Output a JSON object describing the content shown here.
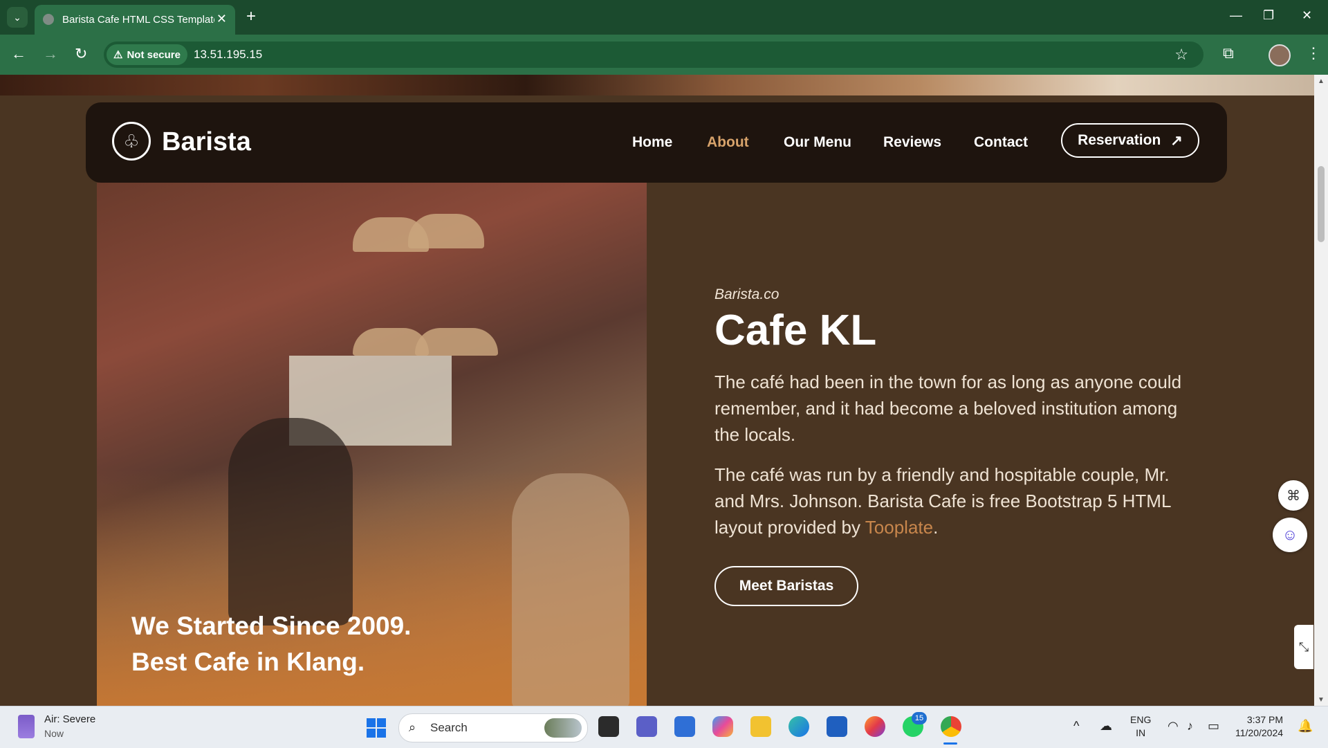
{
  "browser": {
    "tab_title": "Barista Cafe HTML CSS Template",
    "security_label": "Not secure",
    "url": "13.51.195.15"
  },
  "nav": {
    "brand": "Barista",
    "links": [
      "Home",
      "About",
      "Our Menu",
      "Reviews",
      "Contact"
    ],
    "active": "About",
    "reservation_label": "Reservation"
  },
  "photo": {
    "caption_line1": "We Started Since 2009.",
    "caption_line2": "Best Cafe in Klang."
  },
  "about": {
    "eyebrow": "Barista.co",
    "heading": "Cafe KL",
    "para1": "The café had been in the town for as long as anyone could remember, and it had become a beloved institution among the locals.",
    "para2_prefix": "The café was run by a friendly and hospitable couple, Mr. and Mrs. Johnson. Barista Cafe is free Bootstrap 5 HTML layout provided by ",
    "para2_link": "Tooplate",
    "para2_suffix": ".",
    "button_label": "Meet Baristas"
  },
  "taskbar": {
    "weather_title": "Air: Severe",
    "weather_sub": "Now",
    "search_placeholder": "Search",
    "whatsapp_badge": "15",
    "lang_line1": "ENG",
    "lang_line2": "IN",
    "time": "3:37 PM",
    "date": "11/20/2024"
  },
  "colors": {
    "accent": "#d8a36b",
    "link": "#c8864c",
    "page_bg": "#4a3522",
    "navbar_bg": "#1e140e",
    "chrome_green": "#2c7047"
  }
}
